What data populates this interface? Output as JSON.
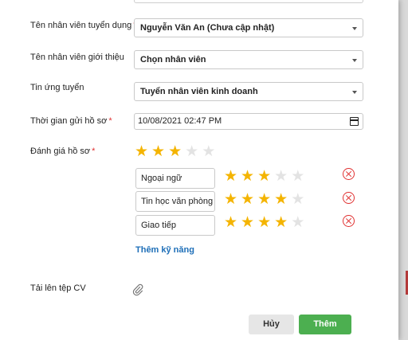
{
  "form": {
    "recruiter": {
      "label": "Tên nhân viên tuyển dụng",
      "required": "*",
      "value": "Nguyễn Văn An (Chưa cập nhật)"
    },
    "referrer": {
      "label": "Tên nhân viên giới thiệu",
      "value": "Chọn nhân viên"
    },
    "job_post": {
      "label": "Tin ứng tuyển",
      "value": "Tuyển nhân viên kinh doanh"
    },
    "submitted_at": {
      "label": "Thời gian gửi hồ sơ",
      "required": "*",
      "value": "10/08/2021 02:47 PM"
    },
    "rating": {
      "label": "Đánh giá hồ sơ",
      "required": "*",
      "overall_stars": 3,
      "max_stars": 5,
      "skills": [
        {
          "name": "Ngoại ngữ",
          "stars": 3
        },
        {
          "name": "Tin học văn phòng",
          "stars": 4
        },
        {
          "name": "Giao tiếp",
          "stars": 4
        }
      ],
      "add_skill_label": "Thêm kỹ năng"
    },
    "cv_upload": {
      "label": "Tải lên tệp CV"
    }
  },
  "actions": {
    "cancel_label": "Hủy",
    "submit_label": "Thêm"
  },
  "colors": {
    "star_on": "#f4b400",
    "star_off": "#e3e3e3",
    "submit": "#4caf50",
    "link": "#1e6fb8",
    "danger": "#e03131"
  },
  "icons": {
    "star": "star-icon",
    "remove": "remove-circle-icon",
    "calendar": "calendar-icon",
    "attach": "paperclip-icon",
    "caret": "caret-down-icon"
  }
}
